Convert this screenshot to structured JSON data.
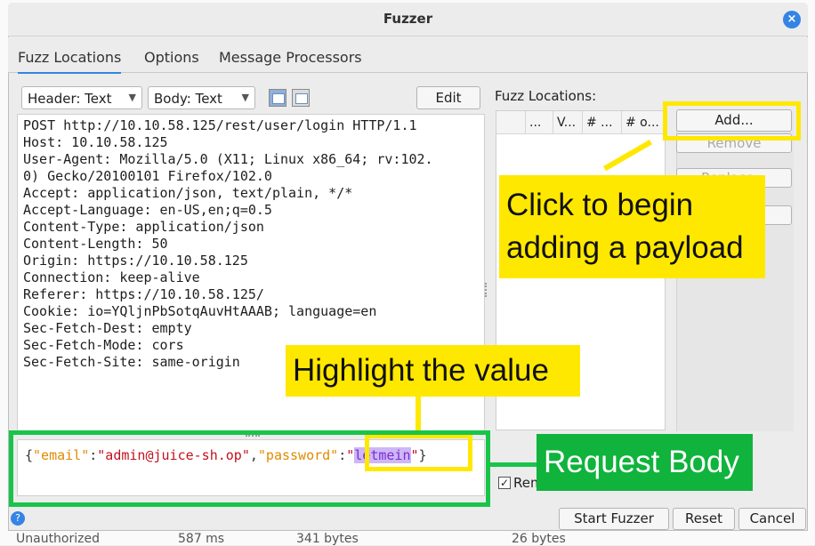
{
  "window": {
    "title": "Fuzzer",
    "close": "×"
  },
  "tabs": [
    "Fuzz Locations",
    "Options",
    "Message Processors"
  ],
  "toolbar": {
    "header_select": "Header: Text",
    "body_select": "Body: Text",
    "edit_label": "Edit"
  },
  "request": {
    "headers": [
      "POST http://10.10.58.125/rest/user/login HTTP/1.1",
      "Host: 10.10.58.125",
      "User-Agent: Mozilla/5.0 (X11; Linux x86_64; rv:102.",
      "0) Gecko/20100101 Firefox/102.0",
      "Accept: application/json, text/plain, */*",
      "Accept-Language: en-US,en;q=0.5",
      "Content-Type: application/json",
      "Content-Length: 50",
      "Origin: https://10.10.58.125",
      "Connection: keep-alive",
      "Referer: https://10.10.58.125/",
      "Cookie: io=YQljnPbSotqAuvHtAAAB; language=en",
      "Sec-Fetch-Dest: empty",
      "Sec-Fetch-Mode: cors",
      "Sec-Fetch-Site: same-origin"
    ],
    "body": {
      "open": "{",
      "key1": "\"email\"",
      "colon1": ":",
      "val1": "\"admin@juice-sh.op\"",
      "comma": ",",
      "key2": "\"password\"",
      "colon2": ":",
      "q1": "\"",
      "val2": "letmein",
      "q2": "\"",
      "close": "}"
    }
  },
  "fuzz_locations": {
    "label": "Fuzz Locations:",
    "columns": [
      "...",
      "V...",
      "# ...",
      "# o..."
    ],
    "buttons": {
      "add": "Add...",
      "remove": "Remove",
      "replace": "Replace...",
      "other": "..."
    },
    "checkbox_label": "Rem"
  },
  "footer": {
    "help": "?",
    "start": "Start Fuzzer",
    "reset": "Reset",
    "cancel": "Cancel"
  },
  "background": {
    "row_status": "Unauthorized",
    "row_time": "587 ms",
    "row_size": "341 bytes",
    "row_size2": "26 bytes"
  },
  "annotations": {
    "add_callout": [
      "Click to begin",
      "adding a payload"
    ],
    "highlight_callout": "Highlight the value",
    "body_callout": "Request Body"
  },
  "colors": {
    "annotation_yellow": "#ffe800",
    "annotation_green": "#10b33c",
    "accent": "#3584e4"
  }
}
